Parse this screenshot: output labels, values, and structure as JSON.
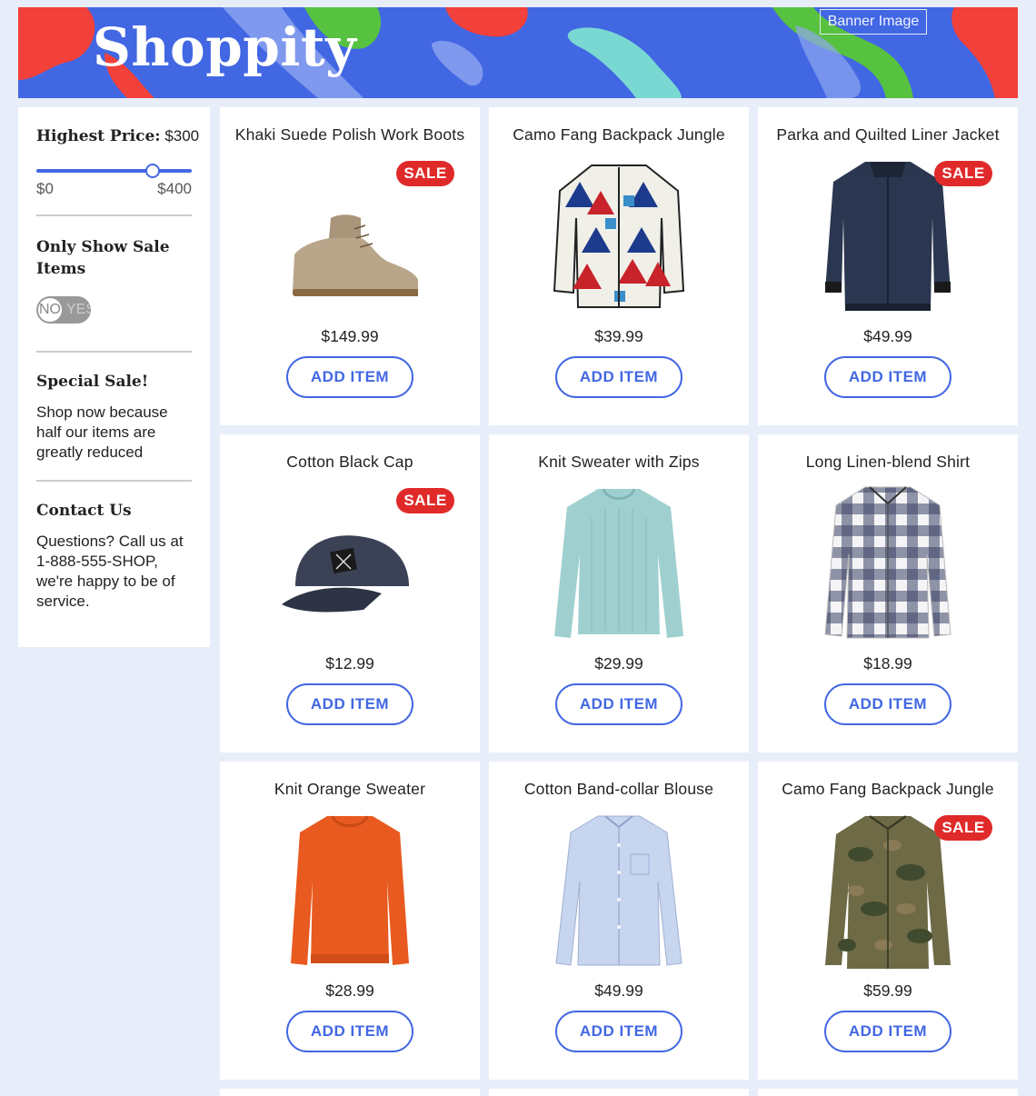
{
  "banner": {
    "brand": "Shoppity",
    "image_alt": "Banner Image"
  },
  "sidebar": {
    "price_label": "Highest Price:",
    "price_value": "$300",
    "slider_min": "$0",
    "slider_max": "$400",
    "slider_level": 0.75,
    "sale_toggle_label": "Only Show Sale Items",
    "toggle_off": "NO",
    "toggle_on": "YES",
    "special_title": "Special Sale!",
    "special_text": "Shop now because half our items are greatly reduced",
    "contact_title": "Contact Us",
    "contact_text": "Questions? Call us at 1-888-555-SHOP, we're happy to be of service."
  },
  "sale_badge": "SALE",
  "add_label": "ADD ITEM",
  "products": [
    {
      "name": "Khaki Suede Polish Work Boots",
      "price": "$149.99",
      "sale": true,
      "icon": "boot"
    },
    {
      "name": "Camo Fang Backpack Jungle",
      "price": "$39.99",
      "sale": false,
      "icon": "patterned-jacket"
    },
    {
      "name": "Parka and Quilted Liner Jacket",
      "price": "$49.99",
      "sale": true,
      "icon": "navy-jacket"
    },
    {
      "name": "Cotton Black Cap",
      "price": "$12.99",
      "sale": true,
      "icon": "cap"
    },
    {
      "name": "Knit Sweater with Zips",
      "price": "$29.99",
      "sale": false,
      "icon": "mint-sweater"
    },
    {
      "name": "Long Linen-blend Shirt",
      "price": "$18.99",
      "sale": false,
      "icon": "plaid-shirt"
    },
    {
      "name": "Knit Orange Sweater",
      "price": "$28.99",
      "sale": false,
      "icon": "orange-sweater"
    },
    {
      "name": "Cotton Band-collar Blouse",
      "price": "$49.99",
      "sale": false,
      "icon": "blue-blouse"
    },
    {
      "name": "Camo Fang Backpack Jungle",
      "price": "$59.99",
      "sale": true,
      "icon": "camo-shirt"
    }
  ],
  "colors": {
    "accent": "#4267e3",
    "sale": "#e02a2a",
    "page_bg": "#e8eef9"
  }
}
